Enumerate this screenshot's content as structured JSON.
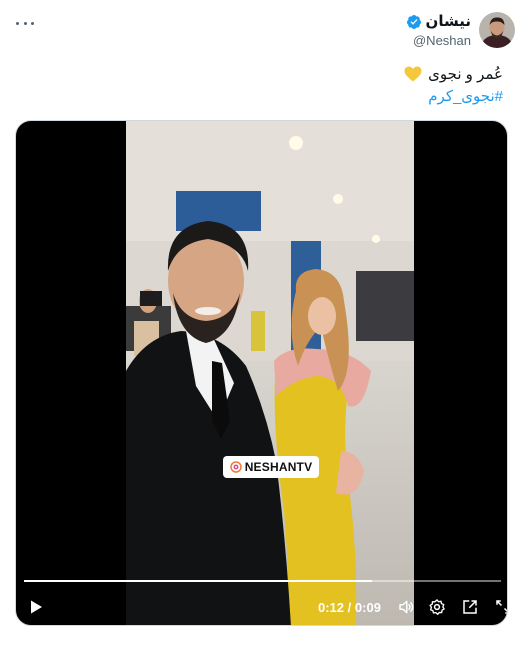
{
  "tweet": {
    "author_name": "نيشان",
    "handle": "@Neshan",
    "text_line1": "عُمر و نجوى",
    "hashtag": "#نجوى_كرم"
  },
  "video": {
    "watermark": "NESHANTV",
    "current_time": "0:12",
    "separator": "/",
    "duration": "0:09",
    "progress_fraction": 0.73
  },
  "icons": {
    "more": "more-horizontal-icon",
    "verified": "verified-badge-icon",
    "heart": "yellow-heart-emoji",
    "play": "play-icon",
    "volume": "volume-icon",
    "settings": "gear-icon",
    "popout": "popout-icon",
    "fullscreen": "fullscreen-icon"
  },
  "colors": {
    "link": "#1d9bf0",
    "verified": "#1d9bf0",
    "heart": "#f5c73a",
    "text": "#0f1419",
    "secondary": "#536471"
  }
}
